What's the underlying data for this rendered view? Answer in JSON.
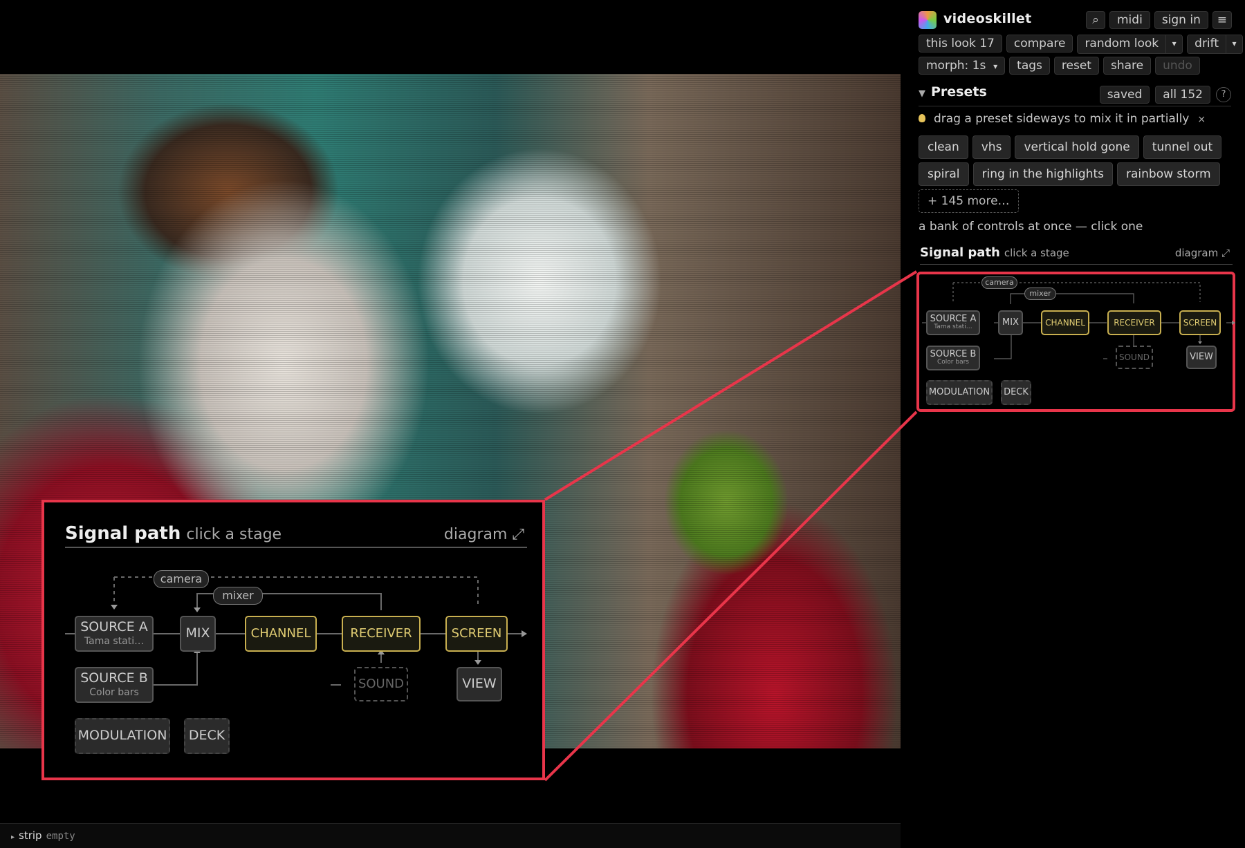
{
  "app": {
    "title": "videoskillet"
  },
  "header": {
    "search_icon": "⌕",
    "midi": "midi",
    "sign_in": "sign in",
    "menu_icon": "≡"
  },
  "toolbar": {
    "this_look": "this look 17",
    "compare": "compare",
    "random_look": "random look",
    "drift": "drift",
    "caret": "▾",
    "morph": "morph: 1s",
    "tags": "tags",
    "reset": "reset",
    "share": "share",
    "undo": "undo"
  },
  "presets": {
    "title": "Presets",
    "collapse_icon": "▼",
    "saved": "saved",
    "all": "all 152",
    "help": "?",
    "tip": "drag a preset sideways to mix it in partially",
    "tip_close": "×",
    "items": [
      "clean",
      "vhs",
      "vertical hold gone",
      "tunnel out",
      "spiral",
      "ring in the highlights",
      "rainbow storm"
    ],
    "more": "+ 145 more…",
    "bank_hint": "a bank of controls at once — click one"
  },
  "signal_path": {
    "title": "Signal path",
    "subtitle": "click a stage",
    "diagram_link": "diagram ⤢",
    "camera": "camera",
    "mixer": "mixer",
    "source_a": "SOURCE A",
    "source_a_sub": "Tama stati…",
    "source_b": "SOURCE B",
    "source_b_sub": "Color bars",
    "mix": "MIX",
    "channel": "CHANNEL",
    "receiver": "RECEIVER",
    "screen": "SCREEN",
    "sound": "SOUND",
    "view": "VIEW",
    "modulation": "MODULATION",
    "deck": "DECK"
  },
  "strip": {
    "label": "strip",
    "status": "empty",
    "arrow": "▸"
  },
  "colors": {
    "accent_highlight": "#e8354a",
    "active_stage": "#c9b050",
    "background": "#000000"
  }
}
